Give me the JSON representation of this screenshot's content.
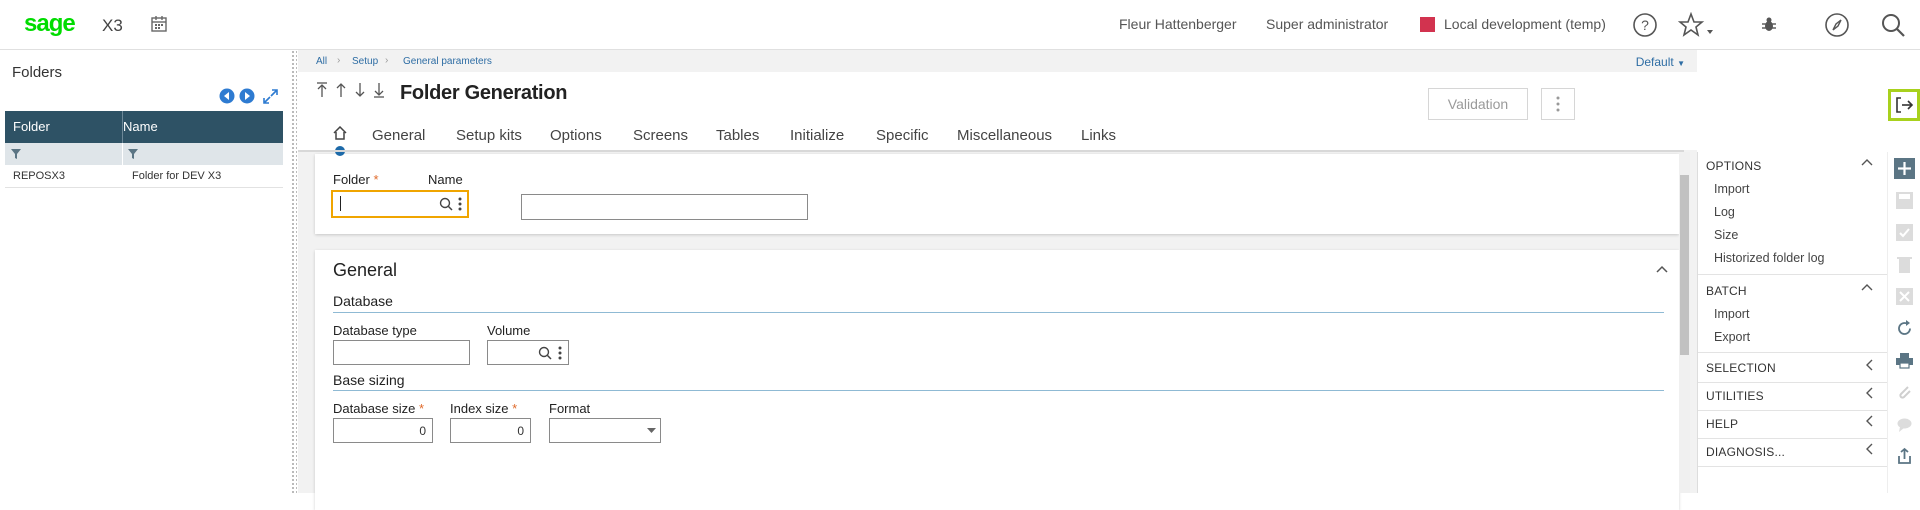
{
  "topbar": {
    "logo": "sage",
    "product": "X3",
    "user": "Fleur Hattenberger",
    "role": "Super administrator",
    "endpoint": "Local development (temp)",
    "endpoint_color": "#d2334f"
  },
  "left_panel": {
    "title": "Folders",
    "columns": [
      "Folder",
      "Name"
    ],
    "rows": [
      {
        "folder": "REPOSX3",
        "name": "Folder for DEV X3"
      }
    ]
  },
  "breadcrumb": [
    "All",
    "Setup",
    "General parameters"
  ],
  "default_label": "Default",
  "page_title": "Folder Generation",
  "validation_label": "Validation",
  "tabs": [
    "General",
    "Setup kits",
    "Options",
    "Screens",
    "Tables",
    "Initialize",
    "Specific",
    "Miscellaneous",
    "Links"
  ],
  "form": {
    "folder_label": "Folder",
    "folder_value": "",
    "name_label": "Name",
    "name_value": "",
    "general_title": "General",
    "database_title": "Database",
    "database_type_label": "Database type",
    "database_type_value": "",
    "volume_label": "Volume",
    "volume_value": "",
    "base_sizing_title": "Base sizing",
    "database_size_label": "Database size",
    "database_size_value": "0",
    "index_size_label": "Index size",
    "index_size_value": "0",
    "format_label": "Format",
    "format_value": ""
  },
  "right_panel": {
    "options_title": "OPTIONS",
    "options_items": [
      "Import",
      "Log",
      "Size",
      "Historized folder log"
    ],
    "batch_title": "BATCH",
    "batch_items": [
      "Import",
      "Export"
    ],
    "selection_title": "SELECTION",
    "utilities_title": "UTILITIES",
    "help_title": "HELP",
    "diagnosis_title": "DIAGNOSIS..."
  },
  "colors": {
    "brand": "#00dc00",
    "table_header": "#2e5265",
    "focus": "#f0a500",
    "exit_highlight": "#a8d11d",
    "link": "#2e6da4"
  },
  "icons": [
    "calendar-icon",
    "help-icon",
    "star-icon",
    "bug-icon",
    "compass-icon",
    "search-icon",
    "exit-icon",
    "plus-icon",
    "refresh-icon",
    "print-icon",
    "share-icon"
  ]
}
